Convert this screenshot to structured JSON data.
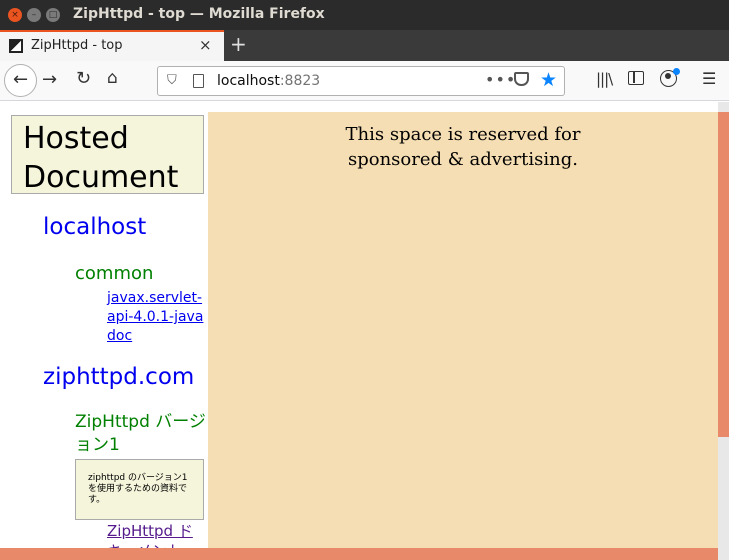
{
  "window": {
    "title": "ZipHttpd - top — Mozilla Firefox",
    "close_glyph": "×",
    "min_glyph": "–",
    "max_glyph": "□"
  },
  "tabs": [
    {
      "title": "ZipHttpd - top",
      "close_glyph": "×",
      "active": true
    }
  ],
  "new_tab_glyph": "+",
  "nav": {
    "back_glyph": "←",
    "forward_glyph": "→",
    "reload_glyph": "↻",
    "home_glyph": "⌂",
    "url_host": "localhost",
    "url_port": ":8823",
    "more_glyph": "•••",
    "bookmark_glyph": "★",
    "library_glyph": "|||\\",
    "menu_glyph": "☰"
  },
  "icons": {
    "shield": "shield-icon",
    "page": "page-icon",
    "pocket": "pocket-icon",
    "star": "star-icon",
    "library": "library-icon",
    "sidebar": "sidebar-icon",
    "account": "account-icon",
    "menu": "hamburger-menu-icon"
  },
  "colors": {
    "accent": "#e95420",
    "link": "#0000ee",
    "visited_link": "#551a8b",
    "group": "#008000",
    "ad_background": "#f5deb3",
    "box_background": "#f5f5dc",
    "scrollbar": "#e8896a",
    "bookmark_star": "#0a84ff"
  },
  "left": {
    "heading": "Hosted Document",
    "hosts": [
      {
        "name": "localhost",
        "groups": [
          {
            "name": "common",
            "docs": [
              {
                "label": "javax.servlet-api-4.0.1-javadoc"
              }
            ]
          }
        ]
      },
      {
        "name": "ziphttpd.com",
        "groups": [
          {
            "name": "ZipHttpd バージョン1",
            "description": "ziphttpd のバージョン1を使用するための資料です。",
            "docs": [
              {
                "label": "ZipHttpd ドキュメント"
              }
            ]
          }
        ]
      }
    ]
  },
  "ad": {
    "line1": "This space is reserved for",
    "line2": "sponsored & advertising."
  }
}
